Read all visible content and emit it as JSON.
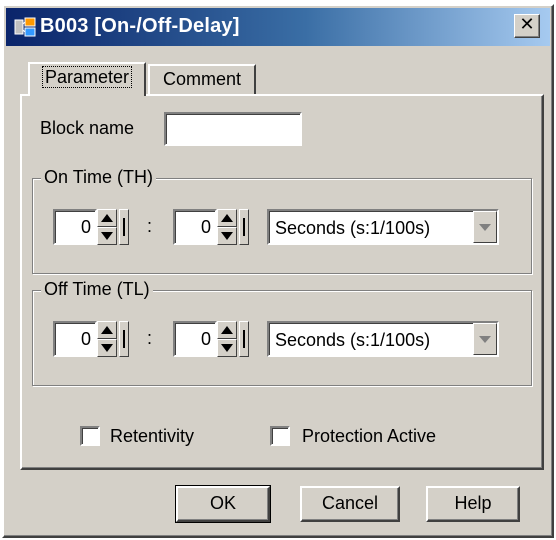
{
  "window": {
    "title": "B003 [On-/Off-Delay]",
    "close_glyph": "✕"
  },
  "tabs": [
    {
      "label": "Parameter",
      "active": true
    },
    {
      "label": "Comment",
      "active": false
    }
  ],
  "block_name": {
    "label": "Block name",
    "value": ""
  },
  "on_time": {
    "title": "On Time (TH)",
    "first_value": "0",
    "separator": ":",
    "second_value": "0",
    "unit": "Seconds (s:1/100s)"
  },
  "off_time": {
    "title": "Off Time (TL)",
    "first_value": "0",
    "separator": ":",
    "second_value": "0",
    "unit": "Seconds (s:1/100s)"
  },
  "options": {
    "retentivity": {
      "label": "Retentivity",
      "checked": false
    },
    "protection": {
      "label": "Protection Active",
      "checked": false
    }
  },
  "buttons": {
    "ok": "OK",
    "cancel": "Cancel",
    "help": "Help"
  }
}
